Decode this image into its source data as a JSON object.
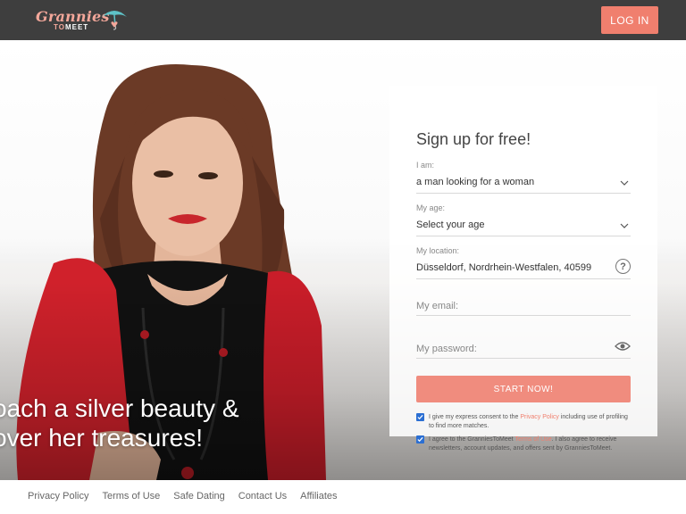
{
  "header": {
    "logo": {
      "line1": "Grannies",
      "line2_a": "TO",
      "line2_b": "MEET",
      "icon": "umbrella-heart-icon"
    },
    "login_label": "LOG IN"
  },
  "hero": {
    "tagline_line1": "oach a silver beauty &",
    "tagline_line2": "over her treasures!"
  },
  "signup": {
    "title": "Sign up for free!",
    "iam": {
      "label": "I am:",
      "value": "a man looking for a woman"
    },
    "age": {
      "label": "My age:",
      "value": "Select your age"
    },
    "location": {
      "label": "My location:",
      "value": "Düsseldorf, Nordrhein-Westfalen, 40599"
    },
    "email": {
      "placeholder": "My email:"
    },
    "password": {
      "placeholder": "My password:"
    },
    "start_label": "START NOW!",
    "consent1": {
      "before": "I give my express consent to the ",
      "link": "Privacy Policy",
      "after": " including use of profiling to find more matches."
    },
    "consent2": {
      "before": "I agree to the GranniesToMeet ",
      "link": "Terms of Use",
      "after": ". I also agree to receive newsletters, account updates, and offers sent by GranniesToMeet."
    }
  },
  "footer": {
    "links": [
      "Privacy Policy",
      "Terms of Use",
      "Safe Dating",
      "Contact Us",
      "Affiliates"
    ]
  },
  "colors": {
    "accent": "#f07f6e",
    "header_bg": "#3e3e3e",
    "checkbox": "#2b6fd3"
  }
}
